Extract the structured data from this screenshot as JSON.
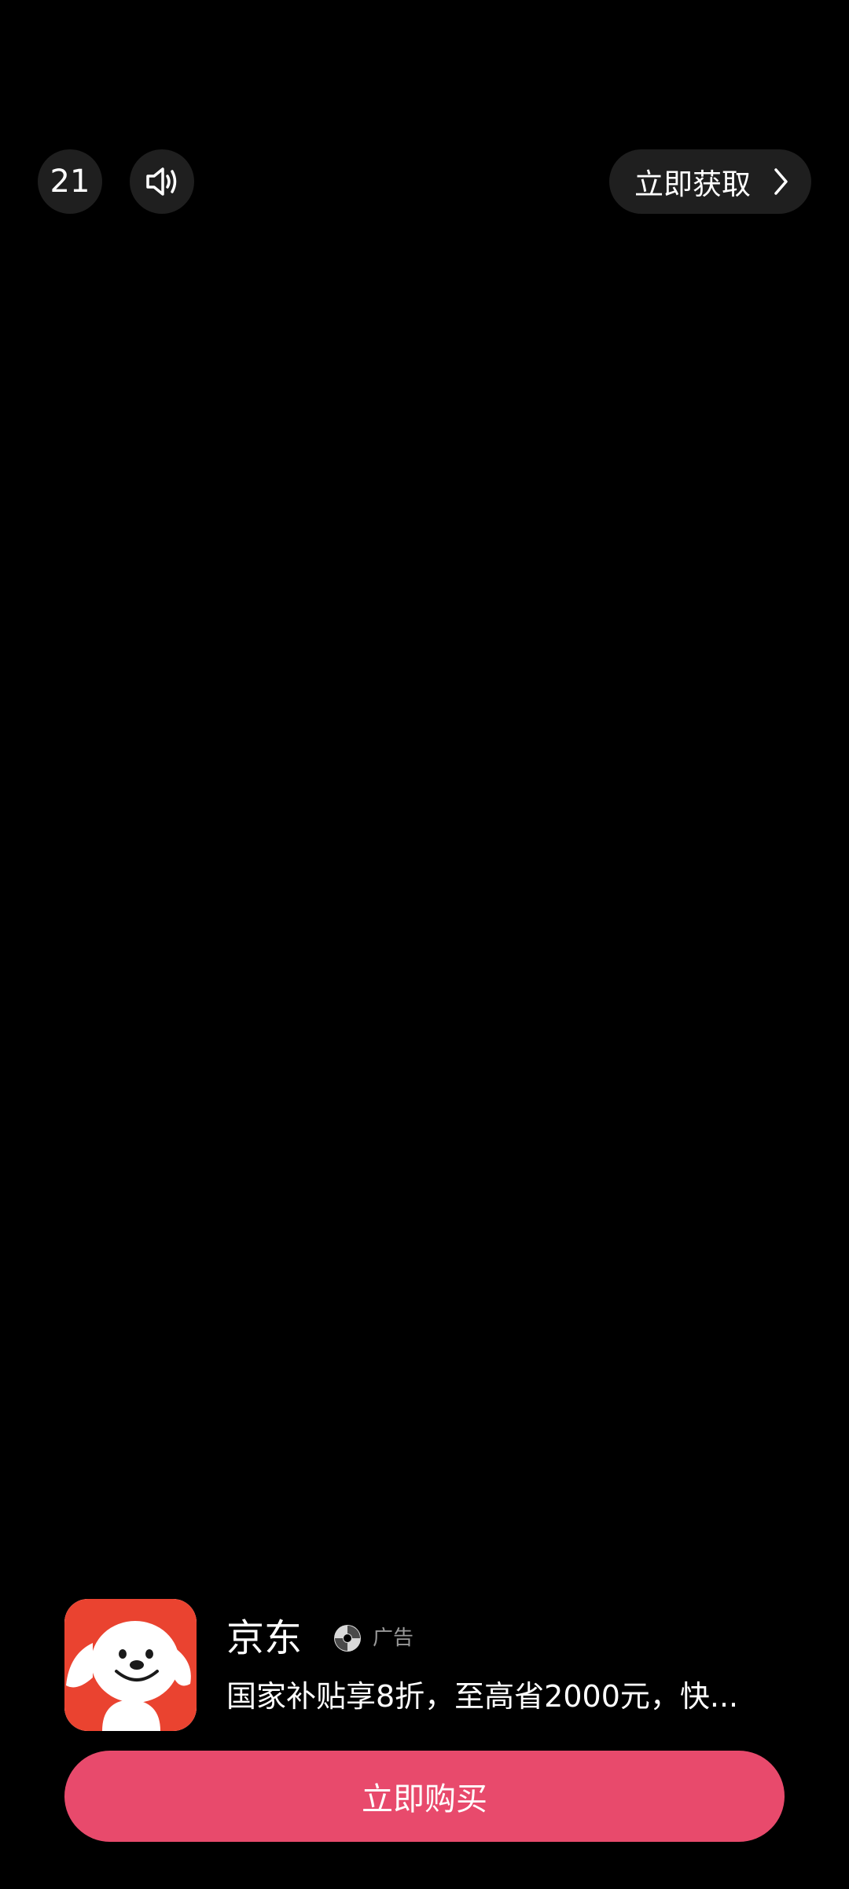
{
  "top_bar": {
    "countdown": "21",
    "sound_icon": "speaker-on-icon",
    "get_now_label": "立即获取",
    "get_now_icon": "chevron-right-icon"
  },
  "ad_card": {
    "app_name": "京东",
    "ad_label": "广告",
    "ad_logo_icon": "ad-network-logo-icon",
    "description": "国家补贴享8折，至高省2000元，快...",
    "app_icon": "jd-mascot-dog-icon",
    "buy_label": "立即购买"
  },
  "colors": {
    "background": "#000000",
    "control_bg": "#1f1f1f",
    "buy_button": "#e84a6c",
    "app_icon_bg": "#ea4330"
  }
}
